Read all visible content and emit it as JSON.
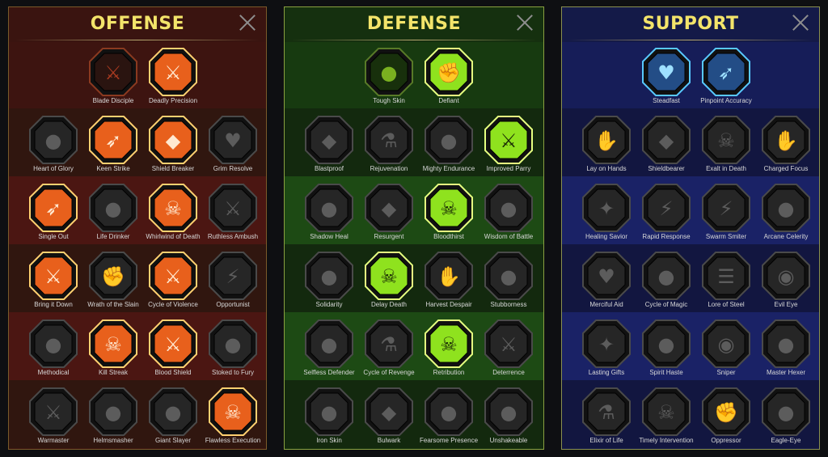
{
  "colors": {
    "title": "#f3e46a",
    "inactive_fill": "#2a2a2a",
    "inactive_icon": "#5a5a5a",
    "offense_active": "#e8501c",
    "defense_active": "#8fe21e",
    "support_active": "#2a6a9a"
  },
  "panels": [
    {
      "title": "OFFENSE",
      "key": "offense",
      "skills": [
        {
          "label": "Blade Disciple",
          "icon": "crossed-swords-icon",
          "state": "dim-red"
        },
        {
          "label": "Deadly Precision",
          "icon": "triple-daggers-icon",
          "state": "active"
        },
        {
          "label": "Heart of Glory",
          "icon": "horned-figure-icon",
          "state": "inactive"
        },
        {
          "label": "Keen Strike",
          "icon": "arrow-strike-icon",
          "state": "active"
        },
        {
          "label": "Shield Breaker",
          "icon": "broken-shield-icon",
          "state": "active"
        },
        {
          "label": "Grim Resolve",
          "icon": "dark-heart-icon",
          "state": "inactive"
        },
        {
          "label": "Single Out",
          "icon": "arrows-target-icon",
          "state": "active"
        },
        {
          "label": "Life Drinker",
          "icon": "fanged-mouth-icon",
          "state": "inactive"
        },
        {
          "label": "Whirlwind of Death",
          "icon": "skull-whirlwind-icon",
          "state": "active"
        },
        {
          "label": "Ruthless Ambush",
          "icon": "dagger-hand-icon",
          "state": "inactive"
        },
        {
          "label": "Bring it Down",
          "icon": "sword-heart-icon",
          "state": "active"
        },
        {
          "label": "Wrath of the Slain",
          "icon": "raised-fist-icon",
          "state": "inactive"
        },
        {
          "label": "Cycle of Violence",
          "icon": "axe-cycle-icon",
          "state": "active"
        },
        {
          "label": "Opportunist",
          "icon": "chains-bolt-icon",
          "state": "inactive"
        },
        {
          "label": "Methodical",
          "icon": "claw-marks-icon",
          "state": "inactive"
        },
        {
          "label": "Kill Streak",
          "icon": "twin-skulls-icon",
          "state": "active"
        },
        {
          "label": "Blood Shield",
          "icon": "sword-shield-icon",
          "state": "active"
        },
        {
          "label": "Stoked to Fury",
          "icon": "fury-figure-icon",
          "state": "inactive"
        },
        {
          "label": "Warmaster",
          "icon": "war-sword-icon",
          "state": "inactive"
        },
        {
          "label": "Helmsmasher",
          "icon": "helmet-icon",
          "state": "inactive"
        },
        {
          "label": "Giant Slayer",
          "icon": "giant-icon",
          "state": "inactive"
        },
        {
          "label": "Flawless Execution",
          "icon": "flaming-skull-icon",
          "state": "active"
        }
      ]
    },
    {
      "title": "DEFENSE",
      "key": "defense",
      "skills": [
        {
          "label": "Tough Skin",
          "icon": "scales-icon",
          "state": "dim-green"
        },
        {
          "label": "Defiant",
          "icon": "raised-fist-icon",
          "state": "active"
        },
        {
          "label": "Blastproof",
          "icon": "blast-shield-icon",
          "state": "inactive"
        },
        {
          "label": "Rejuvenation",
          "icon": "potion-icon",
          "state": "inactive"
        },
        {
          "label": "Mighty Endurance",
          "icon": "armored-figure-icon",
          "state": "inactive"
        },
        {
          "label": "Improved Parry",
          "icon": "crossed-blades-icon",
          "state": "active"
        },
        {
          "label": "Shadow Heal",
          "icon": "shadow-figure-icon",
          "state": "inactive"
        },
        {
          "label": "Resurgent",
          "icon": "knight-shield-icon",
          "state": "inactive"
        },
        {
          "label": "Bloodthirst",
          "icon": "skull-heart-icon",
          "state": "active"
        },
        {
          "label": "Wisdom of Battle",
          "icon": "halo-figure-icon",
          "state": "inactive"
        },
        {
          "label": "Solidarity",
          "icon": "group-icon",
          "state": "inactive"
        },
        {
          "label": "Delay Death",
          "icon": "skull-hourglass-icon",
          "state": "active"
        },
        {
          "label": "Harvest Despair",
          "icon": "open-hand-icon",
          "state": "inactive"
        },
        {
          "label": "Stubborness",
          "icon": "bull-icon",
          "state": "inactive"
        },
        {
          "label": "Selfless Defender",
          "icon": "running-figure-icon",
          "state": "inactive"
        },
        {
          "label": "Cycle of Revenge",
          "icon": "droplets-icon",
          "state": "inactive"
        },
        {
          "label": "Retribution",
          "icon": "sun-skull-icon",
          "state": "active"
        },
        {
          "label": "Deterrence",
          "icon": "sword-circle-icon",
          "state": "inactive"
        },
        {
          "label": "Iron Skin",
          "icon": "iron-warrior-icon",
          "state": "inactive"
        },
        {
          "label": "Bulwark",
          "icon": "wing-shield-icon",
          "state": "inactive"
        },
        {
          "label": "Fearsome Presence",
          "icon": "fearsome-warrior-icon",
          "state": "inactive"
        },
        {
          "label": "Unshakeable",
          "icon": "strong-figure-icon",
          "state": "inactive"
        }
      ]
    },
    {
      "title": "SUPPORT",
      "key": "support",
      "skills": [
        {
          "label": "Steadfast",
          "icon": "heart-plus-icon",
          "state": "active"
        },
        {
          "label": "Pinpoint Accuracy",
          "icon": "target-arrows-icon",
          "state": "active"
        },
        {
          "label": "Lay on Hands",
          "icon": "praying-hands-icon",
          "state": "inactive"
        },
        {
          "label": "Shieldbearer",
          "icon": "shield-rings-icon",
          "state": "inactive"
        },
        {
          "label": "Exalt in Death",
          "icon": "flame-skull-icon",
          "state": "inactive"
        },
        {
          "label": "Charged Focus",
          "icon": "focus-hand-icon",
          "state": "inactive"
        },
        {
          "label": "Healing Savior",
          "icon": "sparkle-figure-icon",
          "state": "inactive"
        },
        {
          "label": "Rapid Response",
          "icon": "lightning-icon",
          "state": "inactive"
        },
        {
          "label": "Swarm Smiter",
          "icon": "zigzag-icon",
          "state": "inactive"
        },
        {
          "label": "Arcane Celerity",
          "icon": "fast-figure-icon",
          "state": "inactive"
        },
        {
          "label": "Merciful Aid",
          "icon": "chain-heart-icon",
          "state": "inactive"
        },
        {
          "label": "Cycle of Magic",
          "icon": "comet-icon",
          "state": "inactive"
        },
        {
          "label": "Lore of Steel",
          "icon": "open-book-icon",
          "state": "inactive"
        },
        {
          "label": "Evil Eye",
          "icon": "angry-eyes-icon",
          "state": "inactive"
        },
        {
          "label": "Lasting Gifts",
          "icon": "star-icon",
          "state": "inactive"
        },
        {
          "label": "Spirit Haste",
          "icon": "winged-boot-icon",
          "state": "inactive"
        },
        {
          "label": "Sniper",
          "icon": "eye-icon",
          "state": "inactive"
        },
        {
          "label": "Master Hexer",
          "icon": "voodoo-doll-icon",
          "state": "inactive"
        },
        {
          "label": "Elixir of Life",
          "icon": "flask-icon",
          "state": "inactive"
        },
        {
          "label": "Timely Intervention",
          "icon": "winged-skull-icon",
          "state": "inactive"
        },
        {
          "label": "Oppressor",
          "icon": "crushing-fist-icon",
          "state": "inactive"
        },
        {
          "label": "Eagle-Eye",
          "icon": "eagle-icon",
          "state": "inactive"
        }
      ]
    }
  ]
}
